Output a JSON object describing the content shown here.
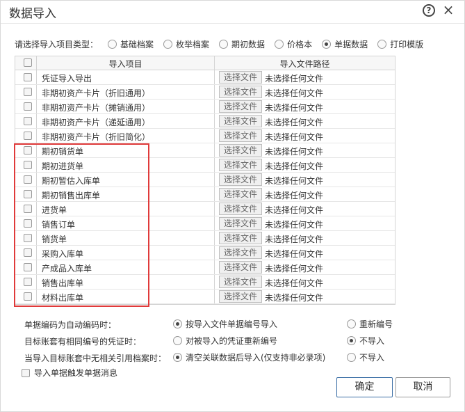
{
  "window": {
    "title": "数据导入"
  },
  "type_selector": {
    "label": "请选择导入项目类型：",
    "options": [
      {
        "label": "基础档案",
        "checked": false
      },
      {
        "label": "枚举档案",
        "checked": false
      },
      {
        "label": "期初数据",
        "checked": false
      },
      {
        "label": "价格本",
        "checked": false
      },
      {
        "label": "单据数据",
        "checked": true
      },
      {
        "label": "打印模版",
        "checked": false
      }
    ]
  },
  "table": {
    "headers": {
      "item": "导入项目",
      "path": "导入文件路径"
    },
    "rows": [
      {
        "name": "凭证导入导出",
        "button": "选择文件",
        "file": "未选择任何文件"
      },
      {
        "name": "非期初资产卡片（折旧通用）",
        "button": "选择文件",
        "file": "未选择任何文件"
      },
      {
        "name": "非期初资产卡片（摊销通用）",
        "button": "选择文件",
        "file": "未选择任何文件"
      },
      {
        "name": "非期初资产卡片（递延通用）",
        "button": "选择文件",
        "file": "未选择任何文件"
      },
      {
        "name": "非期初资产卡片（折旧简化）",
        "button": "选择文件",
        "file": "未选择任何文件"
      },
      {
        "name": "期初销货单",
        "button": "选择文件",
        "file": "未选择任何文件"
      },
      {
        "name": "期初进货单",
        "button": "选择文件",
        "file": "未选择任何文件"
      },
      {
        "name": "期初暂估入库单",
        "button": "选择文件",
        "file": "未选择任何文件"
      },
      {
        "name": "期初销售出库单",
        "button": "选择文件",
        "file": "未选择任何文件"
      },
      {
        "name": "进货单",
        "button": "选择文件",
        "file": "未选择任何文件"
      },
      {
        "name": "销售订单",
        "button": "选择文件",
        "file": "未选择任何文件"
      },
      {
        "name": "销货单",
        "button": "选择文件",
        "file": "未选择任何文件"
      },
      {
        "name": "采购入库单",
        "button": "选择文件",
        "file": "未选择任何文件"
      },
      {
        "name": "产成品入库单",
        "button": "选择文件",
        "file": "未选择任何文件"
      },
      {
        "name": "销售出库单",
        "button": "选择文件",
        "file": "未选择任何文件"
      },
      {
        "name": "材料出库单",
        "button": "选择文件",
        "file": "未选择任何文件"
      }
    ]
  },
  "options": [
    {
      "label": "单据编码为自动编码时：",
      "a": "按导入文件单据编号导入",
      "a_checked": true,
      "b": "重新编号",
      "b_checked": false
    },
    {
      "label": "目标账套有相同编号的凭证时：",
      "a": "对被导入的凭证重新编号",
      "a_checked": false,
      "b": "不导入",
      "b_checked": true
    },
    {
      "label": "当导入目标账套中无相关引用档案时：",
      "a": "清空关联数据后导入(仅支持非必录项)",
      "a_checked": true,
      "b": "不导入",
      "b_checked": false
    }
  ],
  "notify_label": "导入单据触发单据消息",
  "buttons": {
    "ok": "确定",
    "cancel": "取消"
  },
  "colors": {
    "highlight_border": "#e03a3a",
    "ok_border": "#3b6ea5"
  }
}
